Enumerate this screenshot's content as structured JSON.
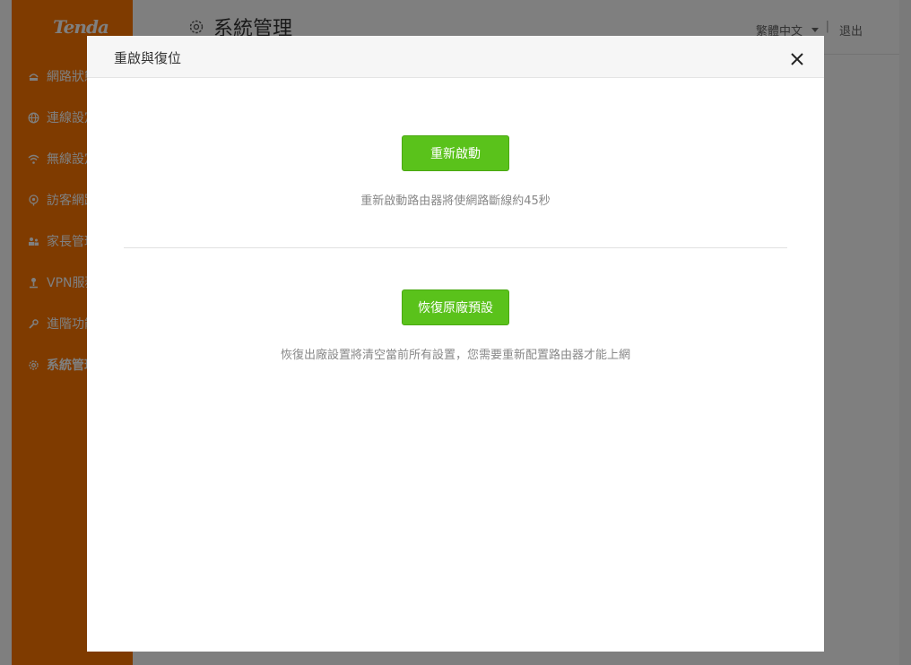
{
  "app": {
    "logo": "Tenda",
    "page_title": "系統管理",
    "language": "繁體中文",
    "separator": "|",
    "logout": "退出"
  },
  "sidebar": {
    "items": [
      {
        "label": "網路狀態",
        "icon": "network-status-icon"
      },
      {
        "label": "連線設定",
        "icon": "globe-icon"
      },
      {
        "label": "無線設定",
        "icon": "wifi-icon"
      },
      {
        "label": "訪客網路",
        "icon": "guest-icon"
      },
      {
        "label": "家長管理",
        "icon": "parental-icon"
      },
      {
        "label": "VPN服務",
        "icon": "vpn-icon"
      },
      {
        "label": "進階功能",
        "icon": "wrench-icon"
      },
      {
        "label": "系統管理",
        "icon": "gear-icon",
        "active": true
      }
    ]
  },
  "modal": {
    "title": "重啟與復位",
    "reboot_button": "重新啟動",
    "reboot_desc": "重新啟動路由器將使網路斷線約45秒",
    "reset_button": "恢復原廠預設",
    "reset_desc": "恢復出廠設置將清空當前所有設置，您需要重新配置路由器才能上網"
  },
  "colors": {
    "sidebar": "#ff7700",
    "button": "#5ac21b",
    "overlay": "rgba(0,0,0,0.5)"
  }
}
